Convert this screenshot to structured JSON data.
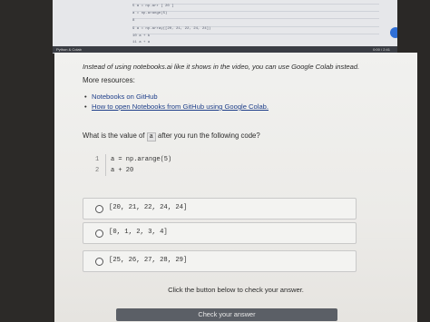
{
  "video": {
    "code_lines": [
      "5 a = np.arr  [ 20 ]",
      "a = np.arange(5)",
      "8",
      "9  a = np.array([20, 21, 22, 24, 24])",
      "10 a + b",
      "11 a + a"
    ],
    "bar_left": "Python & Colab",
    "bar_right": "0:00 / 2:41"
  },
  "note": "Instead of using notebooks.ai like it shows in the video, you can use Google Colab instead.",
  "resources": {
    "heading": "More resources:",
    "items": [
      {
        "label": "Notebooks on GitHub",
        "underline": false
      },
      {
        "label": "How to open Notebooks from GitHub using Google Colab.",
        "underline": true
      }
    ]
  },
  "question": {
    "prefix": "What is the value of",
    "code": "a",
    "suffix": "after you run the following code?"
  },
  "code": [
    {
      "num": "1",
      "text": "a = np.arange(5)"
    },
    {
      "num": "2",
      "text": "a + 20"
    }
  ],
  "options": [
    "[20, 21, 22, 24, 24]",
    "[0, 1, 2, 3, 4]",
    "[25, 26, 27, 28, 29]"
  ],
  "check_prompt": "Click the button below to check your answer.",
  "check_button": "Check your answer"
}
